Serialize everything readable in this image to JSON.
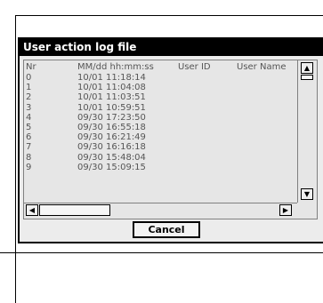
{
  "dialog": {
    "title": "User action log file"
  },
  "columns": [
    "Nr",
    "MM/dd hh:mm:ss",
    "User ID",
    "User Name"
  ],
  "rows": [
    {
      "nr": "0",
      "time": "10/01 11:18:14"
    },
    {
      "nr": "1",
      "time": "10/01 11:04:08"
    },
    {
      "nr": "2",
      "time": "10/01 11:03:51"
    },
    {
      "nr": "3",
      "time": "10/01 10:59:51"
    },
    {
      "nr": "4",
      "time": "09/30 17:23:50"
    },
    {
      "nr": "5",
      "time": "09/30 16:55:18"
    },
    {
      "nr": "6",
      "time": "09/30 16:21:49"
    },
    {
      "nr": "7",
      "time": "09/30 16:16:18"
    },
    {
      "nr": "8",
      "time": "09/30 15:48:04"
    },
    {
      "nr": "9",
      "time": "09/30 15:09:15"
    }
  ],
  "scroll": {
    "up_arrow": "▲",
    "down_arrow": "▼",
    "left_arrow": "◀",
    "right_arrow": "▶"
  },
  "buttons": {
    "cancel": "Cancel"
  },
  "colors": {
    "title_bar": "#000000",
    "title_text": "#ffffff",
    "list_bg": "#e6e6e6",
    "dialog_bg": "#ececec"
  }
}
